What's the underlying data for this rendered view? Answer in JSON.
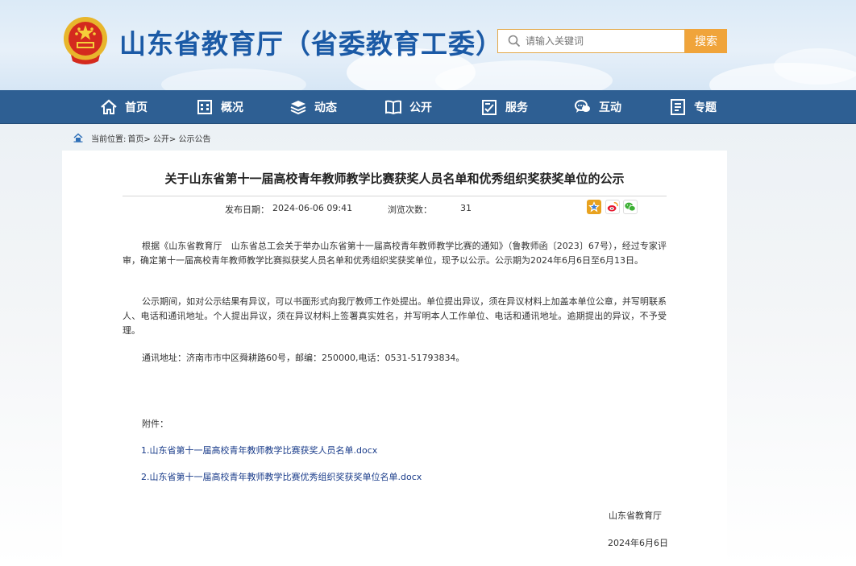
{
  "header": {
    "site_title": "山东省教育厅（省委教育工委）",
    "search_placeholder": "请输入关键词",
    "search_button": "搜索"
  },
  "nav": {
    "items": [
      {
        "label": "首页",
        "icon": "home-icon"
      },
      {
        "label": "概况",
        "icon": "building-icon"
      },
      {
        "label": "动态",
        "icon": "layers-icon"
      },
      {
        "label": "公开",
        "icon": "book-icon"
      },
      {
        "label": "服务",
        "icon": "service-icon"
      },
      {
        "label": "互动",
        "icon": "chat-icon"
      },
      {
        "label": "专题",
        "icon": "document-icon"
      }
    ]
  },
  "breadcrumb": {
    "prefix": "当前位置:",
    "path": "首页> 公开> 公示公告"
  },
  "article": {
    "title": "关于山东省第十一届高校青年教师教学比赛获奖人员名单和优秀组织奖获奖单位的公示",
    "publish_label": "发布日期：",
    "publish_date": "2024-06-06 09:41",
    "views_label": "浏览次数：",
    "views": "31",
    "paragraphs": [
      "根据《山东省教育厅　山东省总工会关于举办山东省第十一届高校青年教师教学比赛的通知》（鲁教师函〔2023〕67号），经过专家评审，确定第十一届高校青年教师教学比赛拟获奖人员名单和优秀组织奖获奖单位，现予以公示。公示期为2024年6月6日至6月13日。",
      "公示期间，如对公示结果有异议，可以书面形式向我厅教师工作处提出。单位提出异议，须在异议材料上加盖本单位公章，并写明联系人、电话和通讯地址。个人提出异议，须在异议材料上签署真实姓名，并写明本人工作单位、电话和通讯地址。逾期提出的异议，不予受理。"
    ],
    "address": "通讯地址：济南市市中区舜耕路60号，邮编：250000,电话：0531-51793834。",
    "attachments_label": "附件：",
    "attachments": [
      "1.山东省第十一届高校青年教师教学比赛获奖人员名单.docx",
      "2.山东省第十一届高校青年教师教学比赛优秀组织奖获奖单位名单.docx"
    ],
    "signature": "山东省教育厅",
    "sign_date": "2024年6月6日"
  },
  "colors": {
    "brand_blue": "#1b5aa6",
    "nav_bg": "#2e5f93",
    "search_orange": "#f0a43a",
    "link_blue": "#1a3c8a"
  }
}
